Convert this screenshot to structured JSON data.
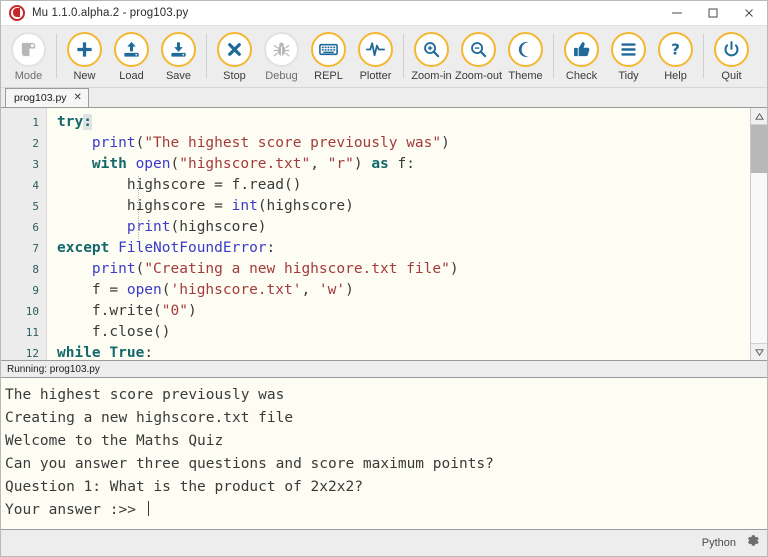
{
  "window": {
    "title": "Mu 1.1.0.alpha.2 - prog103.py",
    "app_icon": "mu-logo-icon",
    "controls": {
      "minimize": "minimize-icon",
      "maximize": "maximize-icon",
      "close": "close-icon"
    }
  },
  "toolbar": {
    "accent_color": "#f5b731",
    "icon_color": "#1f6a99",
    "disabled_color": "#b7b7b7",
    "items": [
      {
        "label": "Mode",
        "icon": "mode-icon",
        "enabled": false
      },
      {
        "label": "New",
        "icon": "plus-icon",
        "enabled": true
      },
      {
        "label": "Load",
        "icon": "upload-icon",
        "enabled": true
      },
      {
        "label": "Save",
        "icon": "download-icon",
        "enabled": true
      },
      {
        "label": "Stop",
        "icon": "cross-icon",
        "enabled": true
      },
      {
        "label": "Debug",
        "icon": "bug-icon",
        "enabled": false
      },
      {
        "label": "REPL",
        "icon": "keyboard-icon",
        "enabled": true
      },
      {
        "label": "Plotter",
        "icon": "pulse-icon",
        "enabled": true
      },
      {
        "label": "Zoom-in",
        "icon": "zoom-in-icon",
        "enabled": true
      },
      {
        "label": "Zoom-out",
        "icon": "zoom-out-icon",
        "enabled": true
      },
      {
        "label": "Theme",
        "icon": "moon-icon",
        "enabled": true
      },
      {
        "label": "Check",
        "icon": "thumbs-up-icon",
        "enabled": true
      },
      {
        "label": "Tidy",
        "icon": "lines-icon",
        "enabled": true
      },
      {
        "label": "Help",
        "icon": "question-icon",
        "enabled": true
      },
      {
        "label": "Quit",
        "icon": "power-icon",
        "enabled": true
      }
    ]
  },
  "tabs": [
    {
      "name": "prog103.py",
      "close": "✕",
      "active": true
    }
  ],
  "editor": {
    "line_numbers": [
      "1",
      "2",
      "3",
      "4",
      "5",
      "6",
      "7",
      "8",
      "9",
      "10",
      "11",
      "12"
    ],
    "lines": [
      "try:",
      "    print(\"The highest score previously was\")",
      "    with open(\"highscore.txt\", \"r\") as f:",
      "        highscore = f.read()",
      "        highscore = int(highscore)",
      "        print(highscore)",
      "except FileNotFoundError:",
      "    print(\"Creating a new highscore.txt file\")",
      "    f = open('highscore.txt', 'w')",
      "    f.write(\"0\")",
      "    f.close()",
      "while True:"
    ],
    "scrollbar": {
      "up_arrow": "scroll-up-icon",
      "down_arrow": "scroll-down-icon"
    }
  },
  "runbar": {
    "text": "Running: prog103.py"
  },
  "output": {
    "lines": [
      "The highest score previously was",
      "Creating a new highscore.txt file",
      "Welcome to the Maths Quiz",
      "Can you answer three questions and score maximum points?",
      "Question 1: What is the product of 2x2x2?",
      "Your answer :>> "
    ]
  },
  "statusbar": {
    "mode": "Python",
    "gear": "gear-icon"
  }
}
